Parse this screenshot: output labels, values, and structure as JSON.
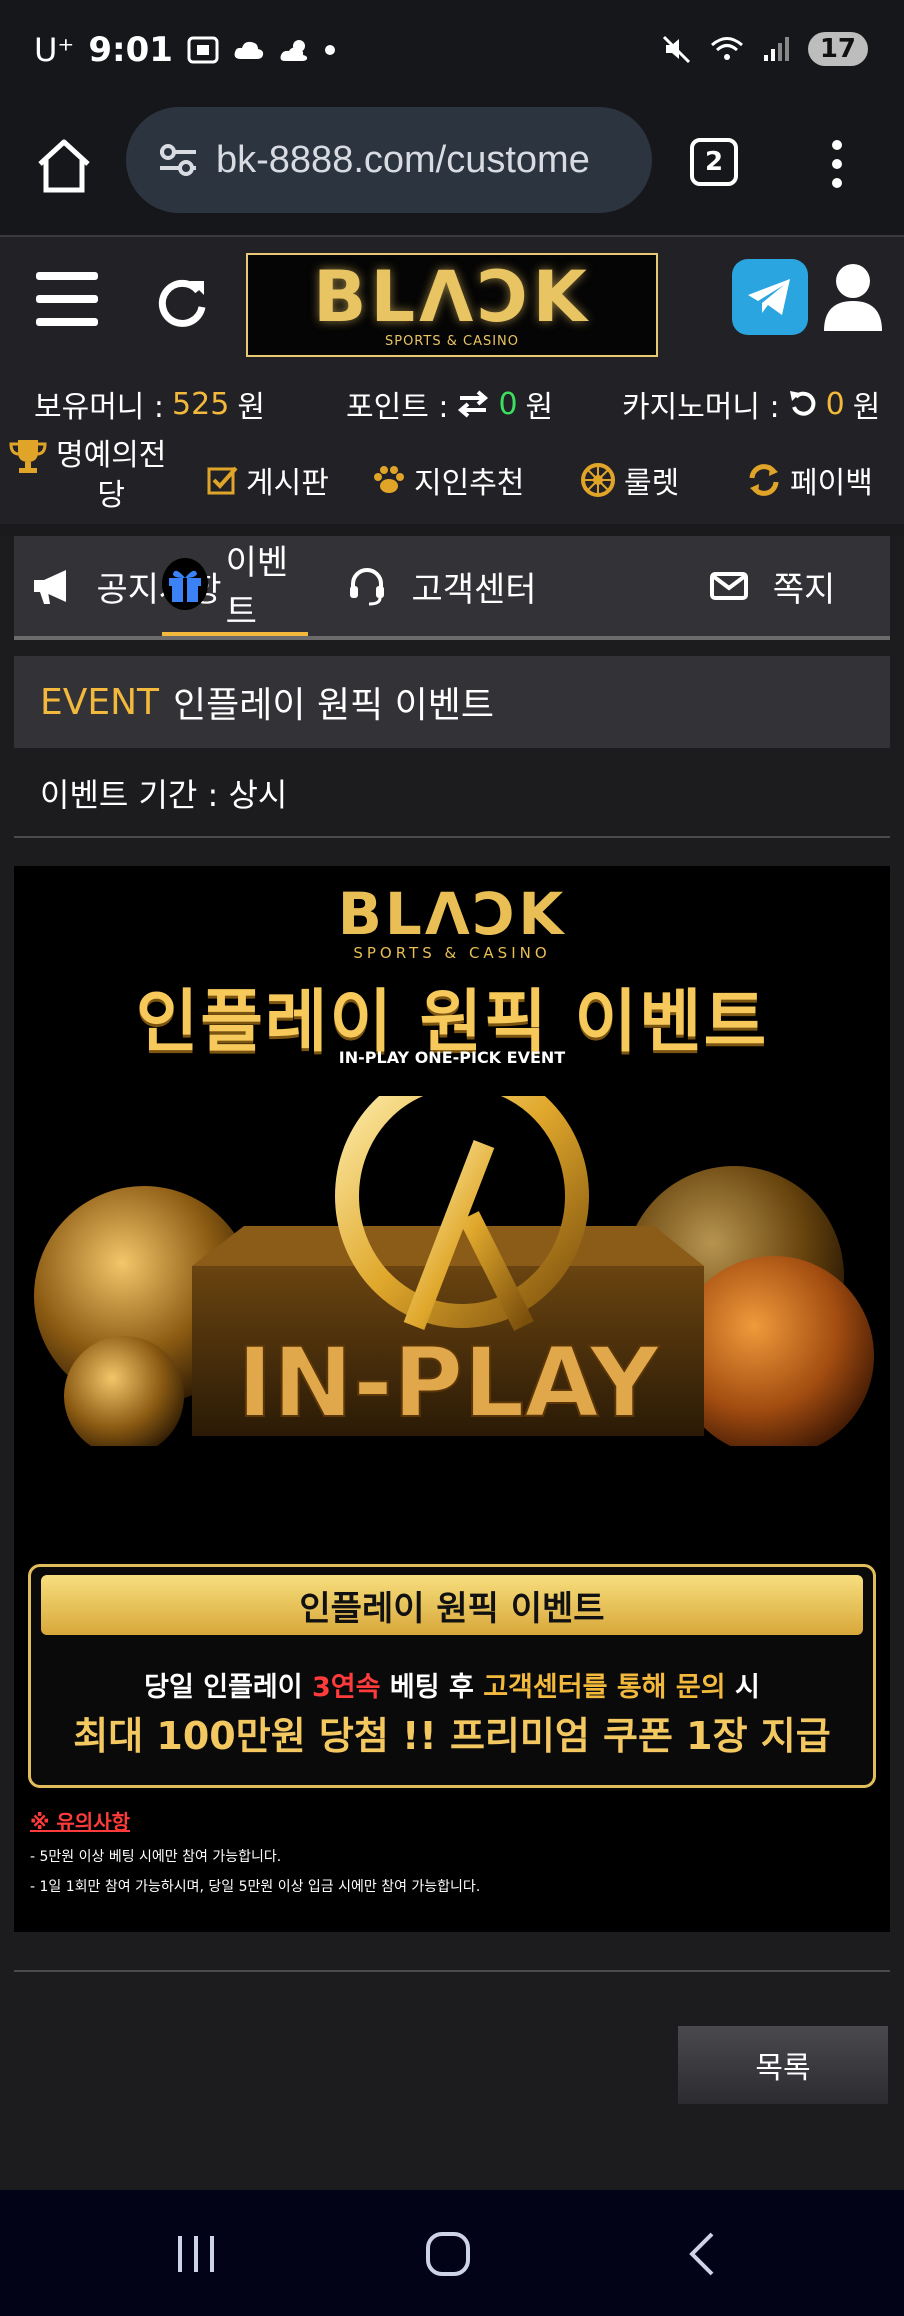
{
  "status_bar": {
    "carrier": "U⁺",
    "time": "9:01",
    "battery": "17"
  },
  "browser": {
    "url": "bk-8888.com/custome",
    "tab_count": "2"
  },
  "header": {
    "logo_text": "BLΛƆK",
    "logo_sub": "SPORTS & CASINO"
  },
  "balances": {
    "money_label": "보유머니 :",
    "money_value": "525",
    "money_unit": "원",
    "points_label": "포인트 :",
    "points_value": "0",
    "points_unit": "원",
    "casino_label": "카지노머니 :",
    "casino_value": "0",
    "casino_unit": "원"
  },
  "quick_menu": {
    "hall_of_fame_1": "명예의전",
    "hall_of_fame_2": "당",
    "board": "게시판",
    "referral": "지인추천",
    "roulette": "룰렛",
    "payback": "페이백"
  },
  "tabs": [
    {
      "label": "공지사항"
    },
    {
      "label": "이벤트"
    },
    {
      "label": "고객센터"
    },
    {
      "label": "쪽지"
    }
  ],
  "event": {
    "tag": "EVENT",
    "title": "인플레이 원픽 이벤트",
    "period": "이벤트 기간 : 상시"
  },
  "banner": {
    "logo_text": "BLΛƆK",
    "logo_sub": "SPORTS & CASINO",
    "headline": "인플레이 원픽 이벤트",
    "subheadline": "IN-PLAY ONE-PICK EVENT",
    "art_text": "IN-PLAY",
    "box_title": "인플레이 원픽 이벤트",
    "line1_a": "당일 인플레이 ",
    "line1_red": "3연속",
    "line1_b": " 베팅 후 ",
    "line1_yel": "고객센터를 통해 문의",
    "line1_c": " 시",
    "line2": "최대 100만원 당첨 !! 프리미엄 쿠폰 1장 지급",
    "notice_title": "※ 유의사항",
    "notice_1": "- 5만원 이상 베팅 시에만 참여 가능합니다.",
    "notice_2": "- 1일 1회만 참여 가능하시며, 당일 5만원 이상 입금 시에만 참여 가능합니다."
  },
  "actions": {
    "list_button": "목록"
  },
  "colors": {
    "accent_gold": "#f2b93c",
    "alert_red": "#ff3b3b",
    "positive_green": "#3ae05e"
  }
}
